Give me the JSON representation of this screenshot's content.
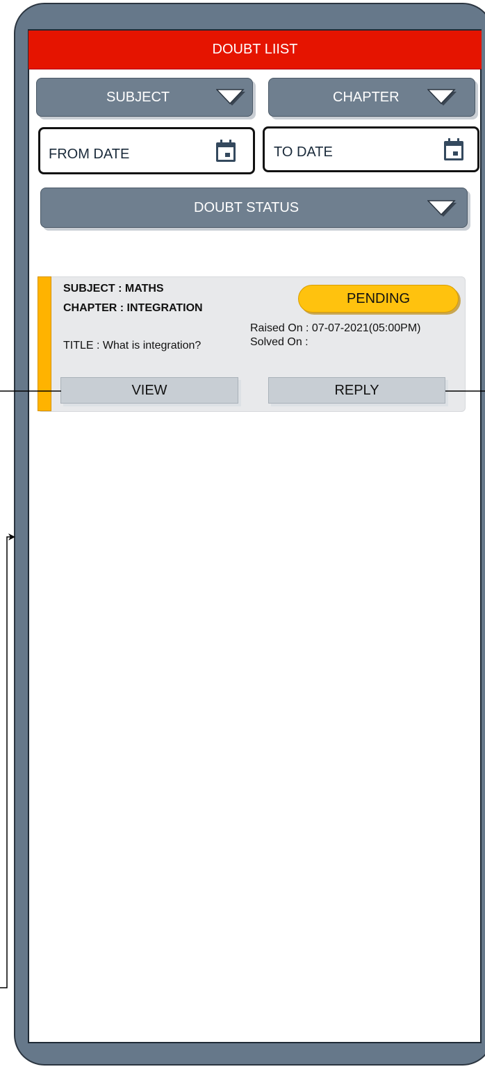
{
  "header": {
    "title": "DOUBT LIIST"
  },
  "filters": {
    "subject_label": "SUBJECT",
    "chapter_label": "CHAPTER",
    "from_date_label": "FROM DATE",
    "to_date_label": "TO DATE",
    "doubt_status_label": "DOUBT STATUS",
    "dropdown_icon": "chevron-down-icon",
    "date_icon": "calendar-icon"
  },
  "doubt_card": {
    "subject_line": "SUBJECT :  MATHS",
    "chapter_line": "CHAPTER : INTEGRATION",
    "title_line": "TITLE : What is integration?",
    "status": "PENDING",
    "raised_on": "Raised  On :  07-07-2021(05:00PM)",
    "solved_on": "Solved  On :",
    "view_label": "VIEW",
    "reply_label": "REPLY"
  },
  "colors": {
    "header_bg": "#e51400",
    "dropdown_bg": "#6f7f8f",
    "phone_frame": "#66788a",
    "status_pending": "#ffc20e",
    "card_accent": "#ffb300"
  }
}
